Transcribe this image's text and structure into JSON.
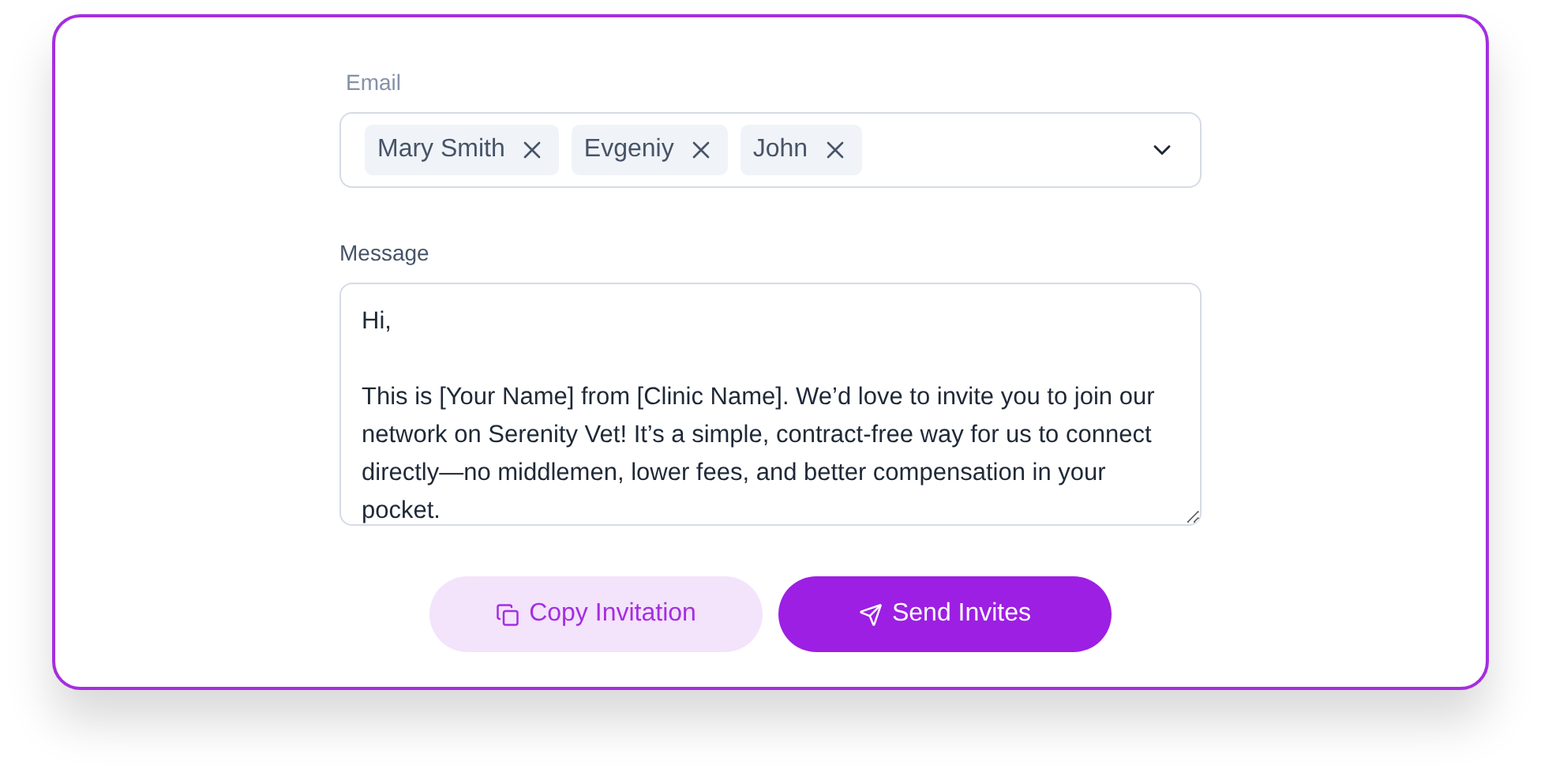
{
  "email": {
    "label": "Email",
    "recipients": [
      {
        "name": "Mary Smith"
      },
      {
        "name": "Evgeniy"
      },
      {
        "name": "John"
      }
    ]
  },
  "message": {
    "label": "Message",
    "value": "Hi,\n\nThis is [Your Name] from [Clinic Name]. We’d love to invite you to join our network on Serenity Vet! It’s a simple, contract-free way for us to connect directly—no middlemen, lower fees, and better compensation in your pocket."
  },
  "buttons": [
    {
      "kind": "secondary",
      "label": "Copy Invitation"
    },
    {
      "kind": "primary",
      "label": "Send Invites"
    }
  ]
}
